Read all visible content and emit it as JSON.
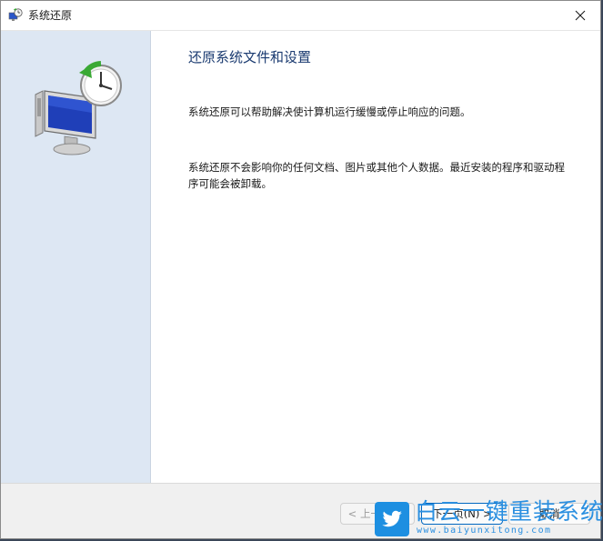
{
  "window": {
    "title": "系统还原",
    "close_icon": "close-icon",
    "app_icon": "system-restore-icon"
  },
  "side_panel": {
    "illustration": "restore-computer-clock-icon",
    "background_color": "#dde7f3"
  },
  "content": {
    "heading": "还原系统文件和设置",
    "paragraph_1": "系统还原可以帮助解决使计算机运行缓慢或停止响应的问题。",
    "paragraph_2": "系统还原不会影响你的任何文档、图片或其他个人数据。最近安装的程序和驱动程序可能会被卸载。"
  },
  "footer": {
    "back_label": "< 上一步(B)",
    "next_label": "下一页(N) >",
    "cancel_label": "取消"
  },
  "watermark": {
    "title": "白云一键重装系统",
    "url": "www.baiyunxitong.com",
    "logo": "twitter-bird-icon"
  },
  "colors": {
    "accent": "#0067c0",
    "heading": "#1a3a70",
    "watermark": "#2a8fe0"
  }
}
